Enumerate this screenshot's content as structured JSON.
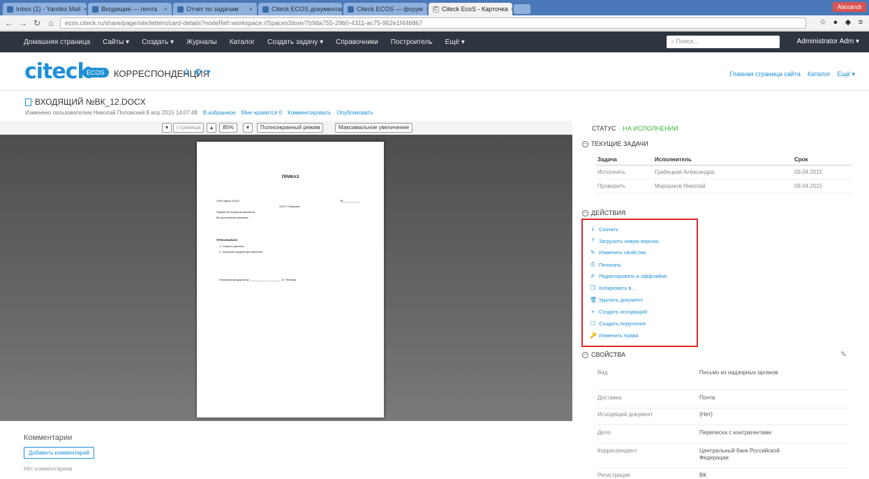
{
  "browser": {
    "tabs": [
      {
        "label": "Inbox (1) - Yandex Mail"
      },
      {
        "label": "Входящие — почта"
      },
      {
        "label": "Отчет по задачам"
      },
      {
        "label": "Citeck ECOS документация"
      },
      {
        "label": "Citeck ECOS — форум"
      },
      {
        "label": "Citeck EcoS - Карточка"
      }
    ],
    "active_tab_index": 5,
    "window_user": "Alexandr",
    "url": "ecos.citeck.ru/share/page/site/letters/card-details?nodeRef=workspace://SpacesStore/7b9da755-29b0-4311-ac75-962e1f44b867"
  },
  "appnav": {
    "items": [
      "Домашняя страница",
      "Сайты ▾",
      "Создать ▾",
      "Журналы",
      "Каталог",
      "Создать задачу ▾",
      "Справочники",
      "Построитель",
      "Ещё ▾"
    ],
    "search_placeholder": "Поиск...",
    "user": "Administrator Adm ▾"
  },
  "site": {
    "logo": "citeck",
    "badge": "ECOS",
    "title": "КОРРЕСПОНДЕНЦИЯ",
    "links": [
      "Главная страница сайта",
      "Каталог",
      "Ещё ▾"
    ]
  },
  "document": {
    "title": "ВХОДЯЩИЙ №ВК_12.DOCX",
    "meta": "Изменено пользователем Николай Поповский 8 апр 2015 14:07:48",
    "meta_links": [
      "В избранное",
      "Мне нравится 0",
      "Комментировать",
      "Опубликовать"
    ]
  },
  "viewer": {
    "page_label": "страница",
    "zoom": "85%",
    "fit_width": "Полноэкранный режим",
    "max": "Максимальное увеличение",
    "doc_heading": "ПРИКАЗ",
    "doc_lines": [
      "«06» марта 2015 г.",
      "№___________",
      "ООО \"Ромашка\"",
      "Приказ об открытии филиала",
      "Во исполнение решения",
      "ПРИКАЗЫВАЮ:",
      "1. Открыть филиал",
      "2. Назначить директора филиала",
      "Генеральный директор ____________________ И. Петрова"
    ]
  },
  "comments": {
    "title": "Комментарии",
    "add_button": "Добавить комментарий",
    "empty": "Нет комментариев"
  },
  "status": {
    "label": "СТАТУС",
    "value": "НА ИСПОЛНЕНИИ"
  },
  "tasks": {
    "section": "ТЕКУЩИЕ ЗАДАЧИ",
    "columns": [
      "Задача",
      "Исполнитель",
      "Срок"
    ],
    "rows": [
      [
        "Исполнить",
        "Грабецкая Александра",
        "09.04.2015"
      ],
      [
        "Проверить",
        "Мирошков Николай",
        "09.04.2015"
      ]
    ]
  },
  "actions": {
    "section": "ДЕЙСТВИЯ",
    "items": [
      {
        "icon": "download-icon",
        "glyph": "⤓",
        "label": "Скачать"
      },
      {
        "icon": "upload-icon",
        "glyph": "⤒",
        "label": "Загрузить новую версию"
      },
      {
        "icon": "edit-properties-icon",
        "glyph": "✎",
        "label": "Изменить свойства"
      },
      {
        "icon": "print-icon",
        "glyph": "⎙",
        "label": "Печатать"
      },
      {
        "icon": "pencil-icon",
        "glyph": "✐",
        "label": "Редактировать в оффлайне"
      },
      {
        "icon": "copy-icon",
        "glyph": "❐",
        "label": "Копировать в..."
      },
      {
        "icon": "delete-icon",
        "glyph": "🗑",
        "label": "Удалить документ"
      },
      {
        "icon": "plus-icon",
        "glyph": "+",
        "label": "Создать исходящий"
      },
      {
        "icon": "task-icon",
        "glyph": "☐",
        "label": "Создать поручение"
      },
      {
        "icon": "rights-icon",
        "glyph": "🔑",
        "label": "Изменить права"
      }
    ]
  },
  "properties": {
    "section": "СВОЙСТВА",
    "rows": [
      {
        "k": "Вид",
        "v": "Письмо из надзорных органов"
      },
      {
        "k": "Доставка",
        "v": "Почта"
      },
      {
        "k": "Исходящий документ",
        "v": "(Нет)"
      },
      {
        "k": "Дело",
        "v": "Переписка с контрагентами"
      },
      {
        "k": "Корреспондент",
        "v": "Центральный банк Российской Федерации"
      },
      {
        "k": "Регистрация",
        "v": "ВК"
      }
    ]
  },
  "colors": {
    "accent": "#1e90d6",
    "status_green": "#3caf3c",
    "highlight": "#e0242e",
    "nav_bg": "#2e3540"
  }
}
